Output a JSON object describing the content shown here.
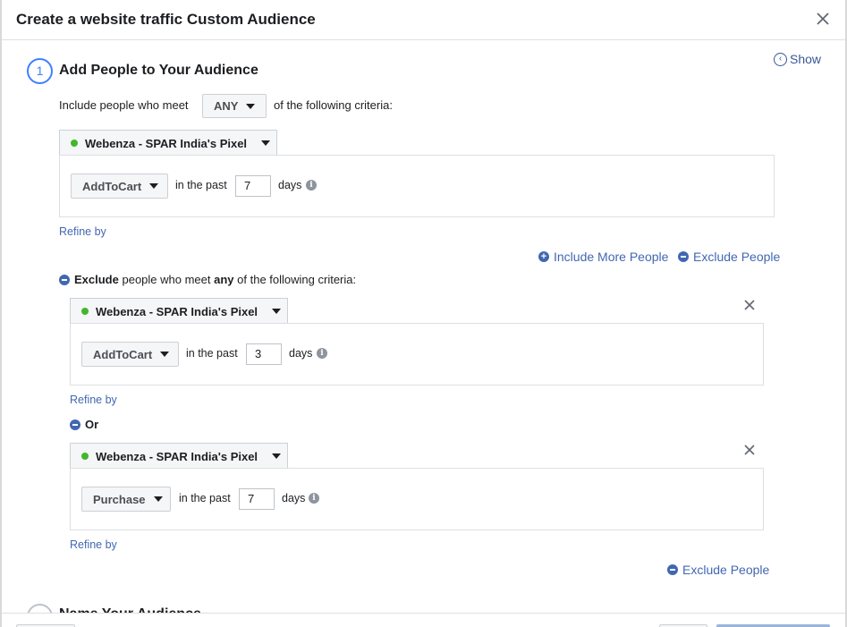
{
  "dialog": {
    "title": "Create a website traffic Custom Audience",
    "show_link": "Show"
  },
  "step1": {
    "number": "1",
    "title": "Add People to Your Audience"
  },
  "include": {
    "prefix": "Include people who meet",
    "match": "ANY",
    "suffix": "of the following criteria:",
    "pixel": "Webenza - SPAR India's Pixel",
    "event": "AddToCart",
    "in_the_past": "in the past",
    "days_value": "7",
    "days_label": "days",
    "refine": "Refine by"
  },
  "actions": {
    "include_more": "Include More People",
    "exclude_people": "Exclude People"
  },
  "exclude": {
    "word_exclude": "Exclude",
    "middle": "people who meet",
    "word_any": "any",
    "suffix": "of the following criteria:",
    "rules": [
      {
        "pixel": "Webenza - SPAR India's Pixel",
        "event": "AddToCart",
        "in_the_past": "in the past",
        "days_value": "3",
        "days_label": "days",
        "refine": "Refine by"
      },
      {
        "pixel": "Webenza - SPAR India's Pixel",
        "event": "Purchase",
        "in_the_past": "in the past",
        "days_value": "7",
        "days_label": "days",
        "refine": "Refine by"
      }
    ],
    "or_label": "Or",
    "exclude_people": "Exclude People"
  },
  "step2": {
    "title": "Name Your Audience"
  },
  "colors": {
    "accent": "#4080ff",
    "link": "#4267b2",
    "pixel_dot": "#42b72a"
  }
}
